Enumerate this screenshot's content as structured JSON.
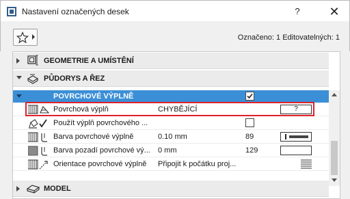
{
  "window": {
    "title": "Nastavení označených desek",
    "help_label": "?",
    "close_label": "✕"
  },
  "toolbar": {
    "selection_info": "Označeno: 1 Editovatelných: 1"
  },
  "sections": {
    "geometry": "GEOMETRIE A UMÍSTĚNÍ",
    "plans": "PŮDORYS A ŘEZ",
    "model": "MODEL"
  },
  "surface": {
    "header": "POVRCHOVÉ VÝPLNĚ",
    "header_checked": true,
    "rows": [
      {
        "label": "Povrchová výplň",
        "value": "CHYBĚJÍCÍ",
        "field": "?"
      },
      {
        "label": "Použít výplň povrchového ...",
        "value": "",
        "checked": false
      },
      {
        "label": "Barva povrchové výplně",
        "value": "0.10 mm",
        "number": "89"
      },
      {
        "label": "Barva pozadí povrchové vý...",
        "value": "0 mm",
        "number": "129"
      },
      {
        "label": "Orientace povrchové výplně",
        "value": "Připojit k počátku proj..."
      }
    ]
  },
  "colors": {
    "selected_row": "#3b8fd6",
    "highlight": "#e0202a"
  }
}
